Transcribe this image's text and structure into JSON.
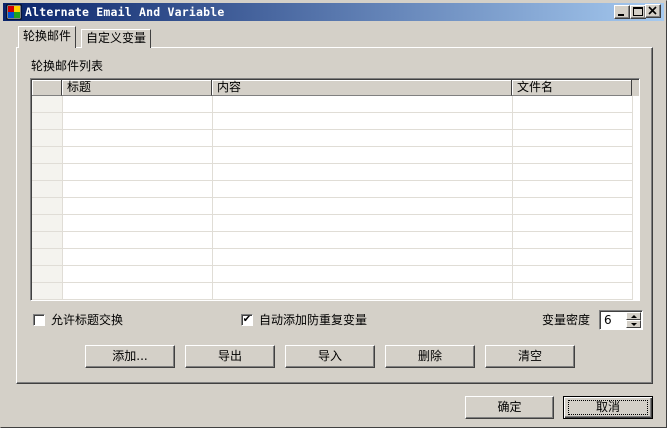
{
  "window": {
    "title": "Alternate Email And Variable"
  },
  "tabs": [
    {
      "label": "轮换邮件",
      "active": true
    },
    {
      "label": "自定义变量",
      "active": false
    }
  ],
  "mail_list": {
    "group_label": "轮换邮件列表",
    "columns": [
      "",
      "标题",
      "内容",
      "文件名"
    ],
    "rows": []
  },
  "options": {
    "allow_title_swap_label": "允许标题交换",
    "allow_title_swap_checked": false,
    "auto_add_var_label": "自动添加防重复变量",
    "auto_add_var_checked": true,
    "check_mark": "✔",
    "density_label": "变量密度",
    "density_value": "6"
  },
  "actions": {
    "add": "添加...",
    "export": "导出",
    "import": "导入",
    "delete": "删除",
    "clear": "清空"
  },
  "dialog": {
    "ok": "确定",
    "cancel": "取消"
  },
  "colors": {
    "face": "#d4d0c8",
    "title_start": "#0a246a",
    "title_end": "#a6caf0"
  }
}
